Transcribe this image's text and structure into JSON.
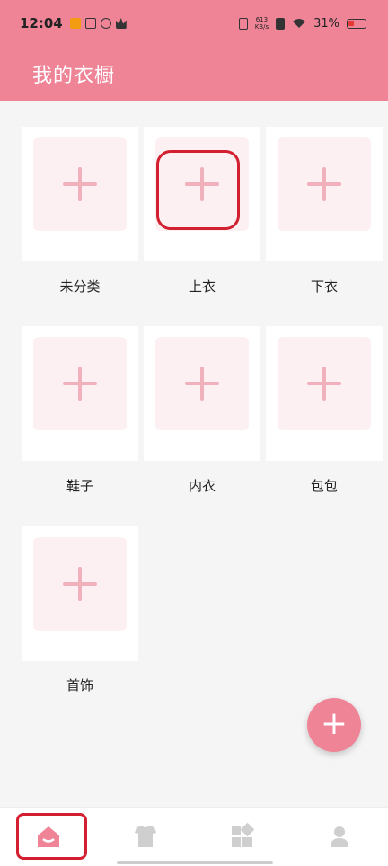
{
  "status_bar": {
    "time": "12:04",
    "net_speed_value": "613",
    "net_speed_unit": "KB/s",
    "battery": "31%"
  },
  "header": {
    "title": "我的衣橱"
  },
  "categories": [
    {
      "label": "未分类"
    },
    {
      "label": "上衣"
    },
    {
      "label": "下衣"
    },
    {
      "label": "鞋子"
    },
    {
      "label": "内衣"
    },
    {
      "label": "包包"
    },
    {
      "label": "首饰"
    }
  ],
  "fab": {
    "icon": "plus-icon"
  },
  "nav": [
    {
      "icon": "home-icon",
      "active": true
    },
    {
      "icon": "shirt-icon",
      "active": false
    },
    {
      "icon": "grid-icon",
      "active": false
    },
    {
      "icon": "user-icon",
      "active": false
    }
  ],
  "colors": {
    "accent": "#ef8497",
    "thumb_bg": "#fdf0f3",
    "plus": "#f0b0bc",
    "highlight": "#d32030",
    "nav_inactive": "#cfcfcf"
  }
}
